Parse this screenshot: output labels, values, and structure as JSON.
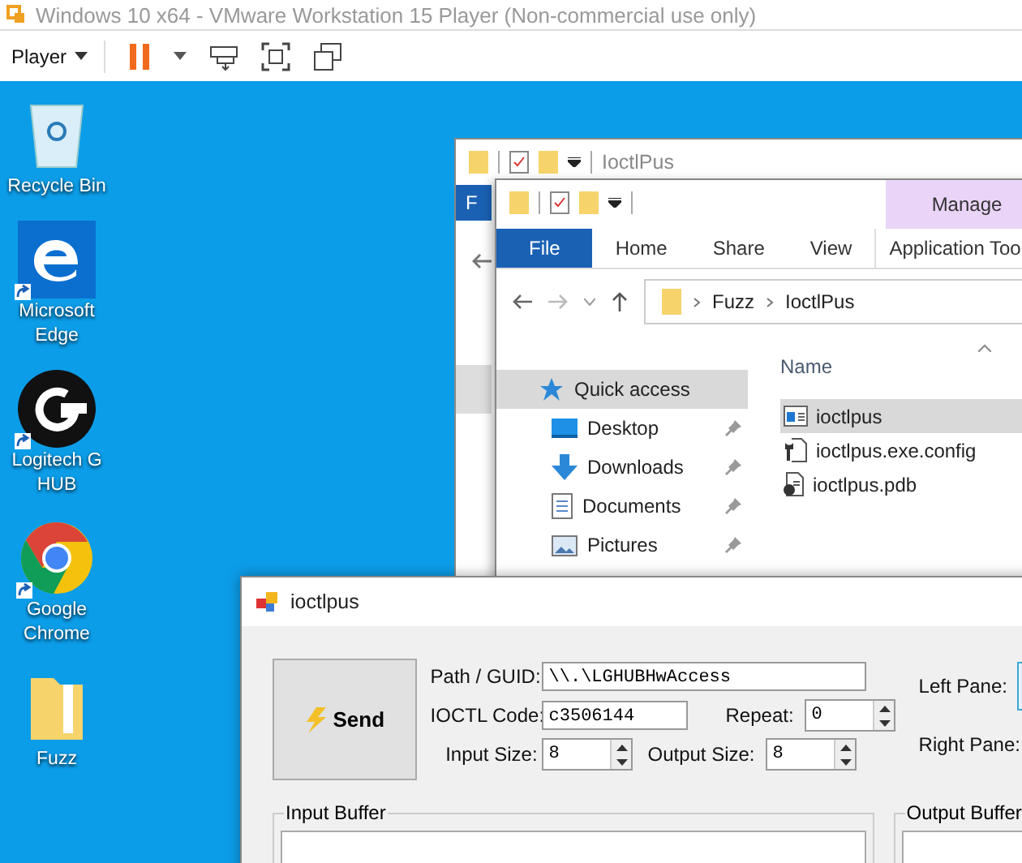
{
  "host": {
    "title": "Windows 10 x64 - VMware Workstation 15 Player (Non-commercial use only)",
    "menu": "Player"
  },
  "desktop_icons": [
    {
      "label": "Recycle Bin",
      "kind": "recycle",
      "shortcut": false
    },
    {
      "label": "Microsoft Edge",
      "kind": "edge",
      "shortcut": true
    },
    {
      "label": "Logitech G HUB",
      "kind": "ghub",
      "shortcut": true
    },
    {
      "label": "Google Chrome",
      "kind": "chrome",
      "shortcut": true
    },
    {
      "label": "Fuzz",
      "kind": "folder",
      "shortcut": false
    }
  ],
  "back_explorer": {
    "title": "IoctlPus",
    "tab": "F"
  },
  "explorer": {
    "context_tab": "Manage",
    "ribbon_tabs": [
      {
        "label": "File",
        "selected": true
      },
      {
        "label": "Home",
        "selected": false
      },
      {
        "label": "Share",
        "selected": false
      },
      {
        "label": "View",
        "selected": false
      },
      {
        "label": "Application Too",
        "selected": false
      }
    ],
    "breadcrumb": [
      "Fuzz",
      "IoctlPus"
    ],
    "column": "Name",
    "nav": [
      {
        "label": "Quick access",
        "kind": "star",
        "pinned": false,
        "selected": true
      },
      {
        "label": "Desktop",
        "kind": "desktop",
        "pinned": true,
        "selected": false
      },
      {
        "label": "Downloads",
        "kind": "download",
        "pinned": true,
        "selected": false
      },
      {
        "label": "Documents",
        "kind": "document",
        "pinned": true,
        "selected": false
      },
      {
        "label": "Pictures",
        "kind": "picture",
        "pinned": true,
        "selected": false
      }
    ],
    "files": [
      {
        "name": "ioctlpus",
        "kind": "app",
        "selected": true
      },
      {
        "name": "ioctlpus.exe.config",
        "kind": "config",
        "selected": false
      },
      {
        "name": "ioctlpus.pdb",
        "kind": "pdb",
        "selected": false
      }
    ]
  },
  "app": {
    "title": "ioctlpus",
    "send": "Send",
    "path_label": "Path / GUID:",
    "path": "\\\\.\\LGHUBHwAccess",
    "code_label": "IOCTL Code:",
    "code": "c3506144",
    "repeat_label": "Repeat:",
    "repeat": "0",
    "input_size_label": "Input Size:",
    "input_size": "8",
    "output_size_label": "Output Size:",
    "output_size": "8",
    "left_pane_label": "Left Pane:",
    "right_pane_label": "Right Pane:",
    "input_buffer": "Input Buffer",
    "output_buffer": "Output Buffer"
  }
}
